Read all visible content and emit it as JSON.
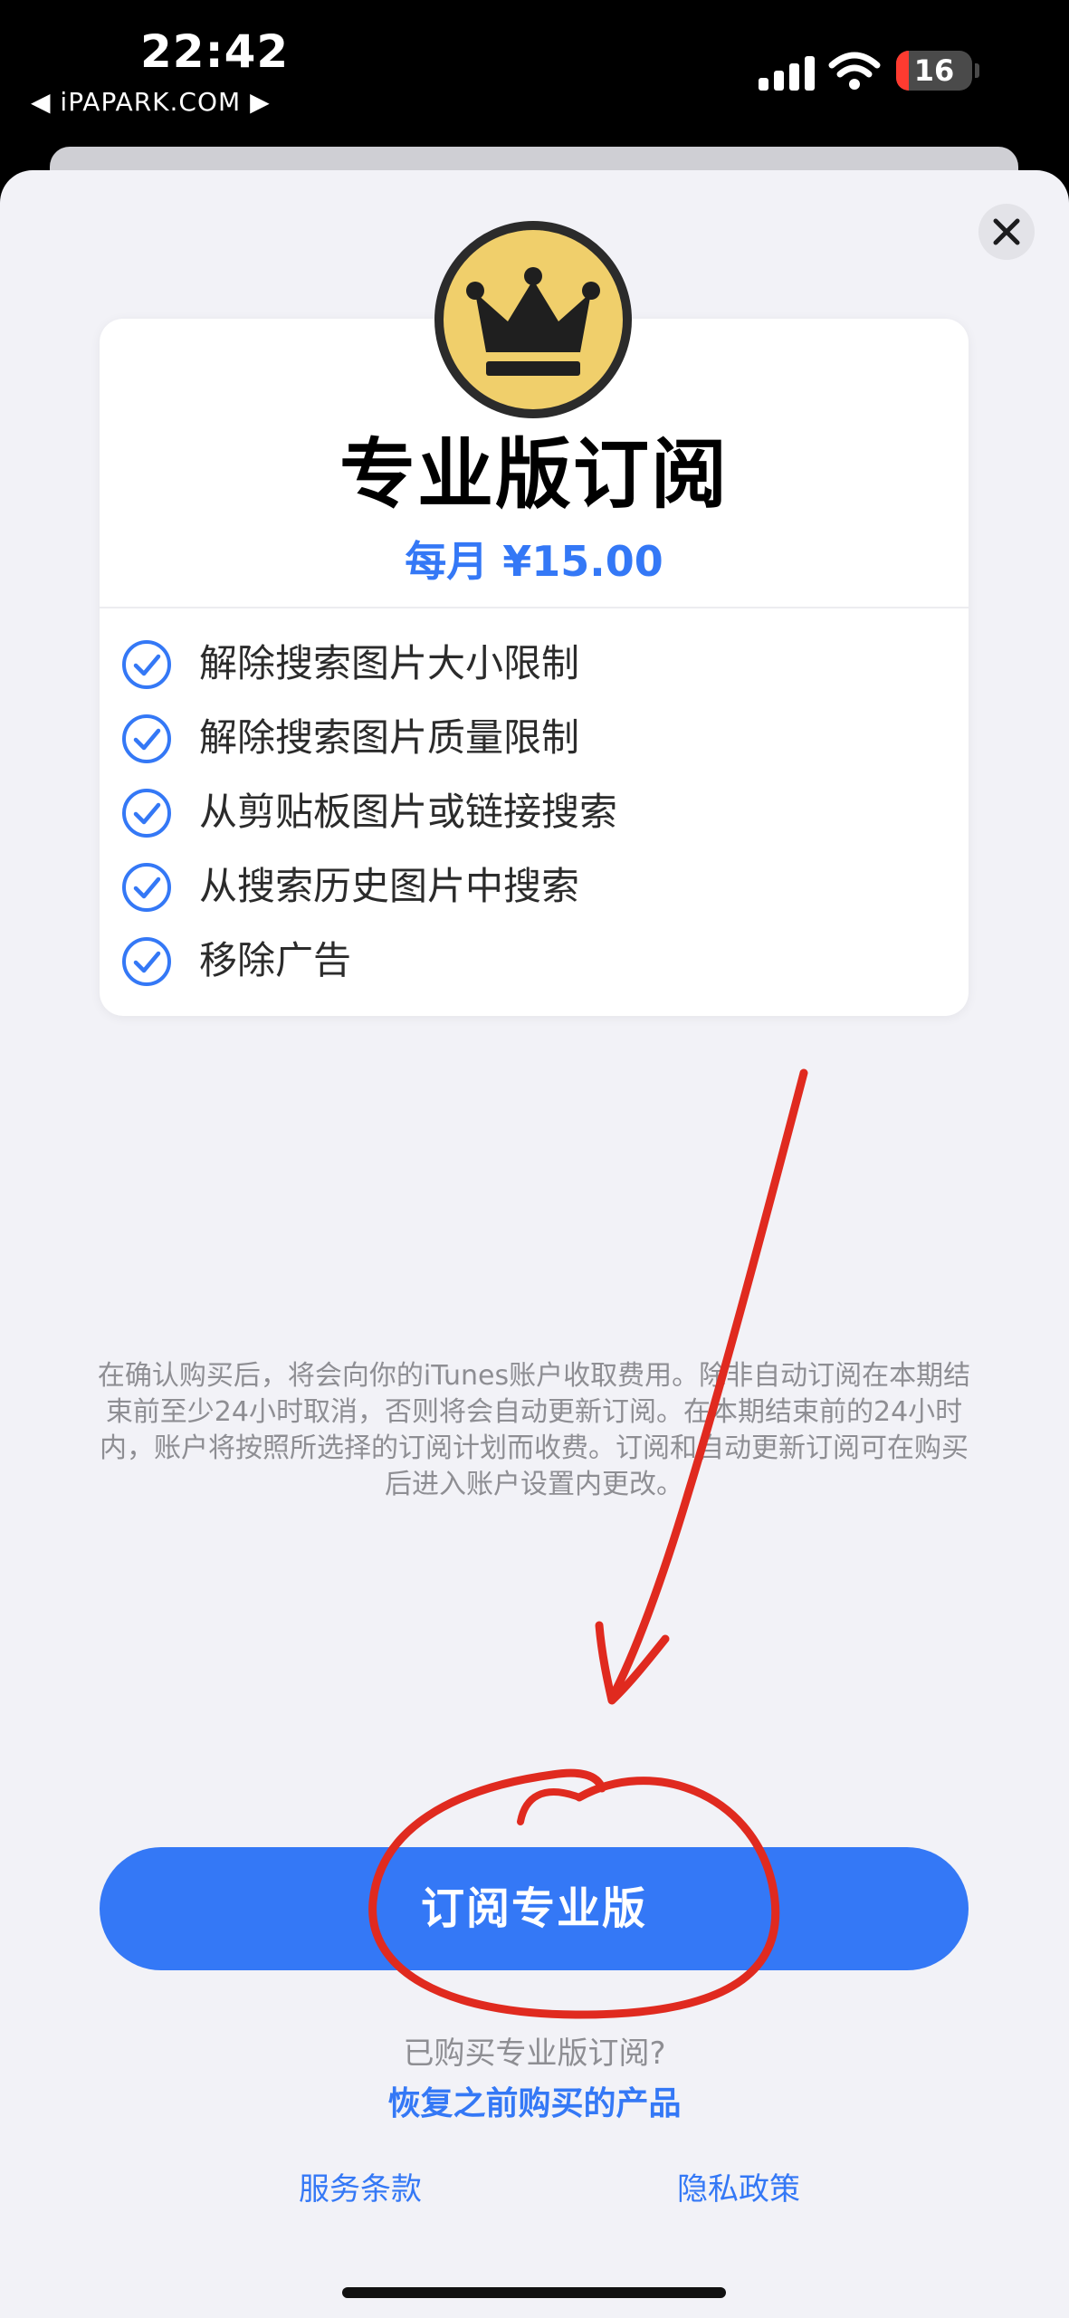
{
  "status_bar": {
    "time": "22:42",
    "carrier": "◀ iPAPARK.COM ▶",
    "battery_level": "16",
    "icons": [
      "signal-icon",
      "wifi-icon",
      "battery-icon"
    ]
  },
  "sheet": {
    "close_icon": "close-icon",
    "crown_icon": "crown-icon",
    "title": "专业版订阅",
    "price": "每月 ¥15.00",
    "features": [
      {
        "label": "解除搜索图片大小限制"
      },
      {
        "label": "解除搜索图片质量限制"
      },
      {
        "label": "从剪贴板图片或链接搜索"
      },
      {
        "label": "从搜索历史图片中搜索"
      },
      {
        "label": "移除广告"
      }
    ],
    "disclaimer": "在确认购买后，将会向你的iTunes账户收取费用。除非自动订阅在本期结束前至少24小时取消，否则将会自动更新订阅。在本期结束前的24小时内，账户将按照所选择的订阅计划而收费。订阅和自动更新订阅可在购买后进入账户设置内更改。",
    "subscribe_label": "订阅专业版",
    "purchased_text": "已购买专业版订阅?",
    "restore_label": "恢复之前购买的产品",
    "terms_label": "服务条款",
    "privacy_label": "隐私政策"
  },
  "colors": {
    "accent": "#3478f6",
    "crown_gold": "#f0cf6b",
    "annotation_red": "#e02a1f",
    "sheet_background": "#f2f2f7"
  }
}
